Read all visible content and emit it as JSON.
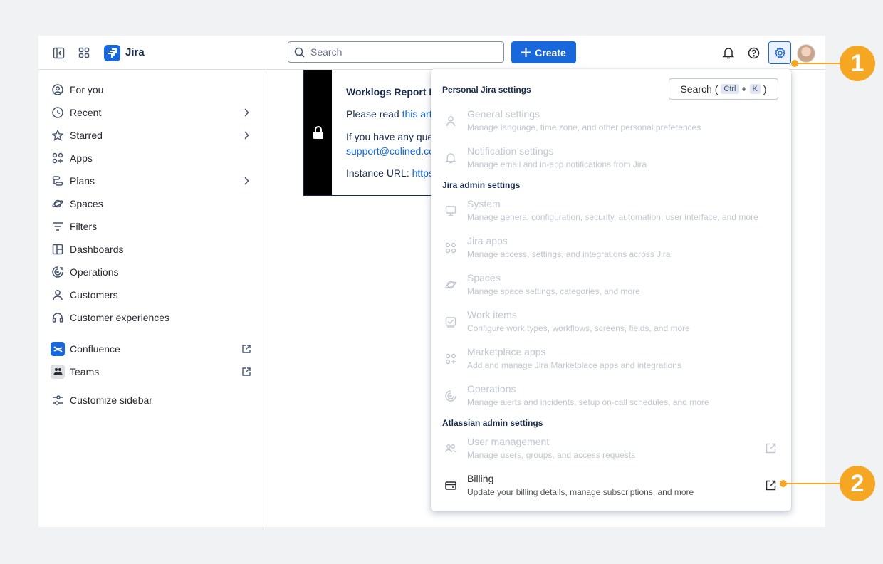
{
  "topbar": {
    "brand": "Jira",
    "search_placeholder": "Search",
    "create_label": "Create"
  },
  "sidebar": {
    "items": [
      {
        "label": "For you",
        "icon": "user-circle-icon"
      },
      {
        "label": "Recent",
        "icon": "clock-icon"
      },
      {
        "label": "Starred",
        "icon": "star-icon"
      },
      {
        "label": "Apps",
        "icon": "apps-icon"
      },
      {
        "label": "Plans",
        "icon": "plans-icon"
      },
      {
        "label": "Spaces",
        "icon": "planet-icon"
      },
      {
        "label": "Filters",
        "icon": "filter-icon"
      },
      {
        "label": "Dashboards",
        "icon": "dashboard-icon"
      },
      {
        "label": "Operations",
        "icon": "operations-icon"
      },
      {
        "label": "Customers",
        "icon": "person-icon"
      },
      {
        "label": "Customer experiences",
        "icon": "headset-icon"
      },
      {
        "label": "Confluence",
        "icon": "confluence-icon"
      },
      {
        "label": "Teams",
        "icon": "teams-icon"
      },
      {
        "label": "Customize sidebar",
        "icon": "customize-icon"
      }
    ]
  },
  "notice": {
    "title": "Worklogs Report I",
    "line1_prefix": "Please read ",
    "line1_link": "this art",
    "line2": "If you have any que",
    "line3_link": "support@colined.co",
    "line4_prefix": "Instance URL: ",
    "line4_link": "https"
  },
  "dropdown": {
    "personal_title": "Personal Jira settings",
    "search_label": "Search (",
    "kbd_ctrl": "Ctrl",
    "kbd_plus": "+",
    "kbd_k": "K",
    "search_close": ")",
    "admin_title": "Jira admin settings",
    "atlassian_title": "Atlassian admin settings",
    "items": [
      {
        "title": "General settings",
        "desc": "Manage language, time zone, and other personal preferences"
      },
      {
        "title": "Notification settings",
        "desc": "Manage email and in-app notifications from Jira"
      },
      {
        "title": "System",
        "desc": "Manage general configuration, security, automation, user interface, and more"
      },
      {
        "title": "Jira apps",
        "desc": "Manage access, settings, and integrations across Jira"
      },
      {
        "title": "Spaces",
        "desc": "Manage space settings, categories, and more"
      },
      {
        "title": "Work items",
        "desc": "Configure work types, workflows, screens, fields, and more"
      },
      {
        "title": "Marketplace apps",
        "desc": "Add and manage Jira Marketplace apps and integrations"
      },
      {
        "title": "Operations",
        "desc": "Manage alerts and incidents, setup on-call schedules, and more"
      },
      {
        "title": "User management",
        "desc": "Manage users, groups, and access requests"
      },
      {
        "title": "Billing",
        "desc": "Update your billing details, manage subscriptions, and more"
      }
    ]
  },
  "callouts": {
    "one": "1",
    "two": "2"
  },
  "colors": {
    "accent": "#1868db",
    "callout": "#f5a623"
  }
}
